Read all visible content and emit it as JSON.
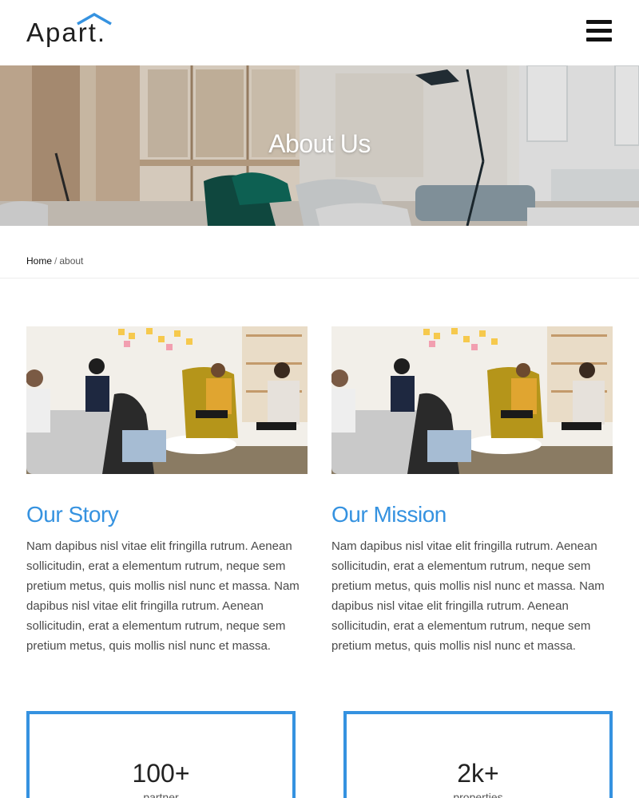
{
  "header": {
    "logo_text": "Apart.",
    "menu_icon": "hamburger-menu-icon"
  },
  "hero": {
    "title": "About Us"
  },
  "breadcrumb": {
    "home": "Home",
    "separator": "/",
    "current": "about"
  },
  "sections": [
    {
      "title": "Our Story",
      "text": "Nam dapibus nisl vitae elit fringilla rutrum. Aenean sollicitudin, erat a elementum rutrum, neque sem pretium metus, quis mollis nisl nunc et massa. Nam dapibus nisl vitae elit fringilla rutrum. Aenean sollicitudin, erat a elementum rutrum, neque sem pretium metus, quis mollis nisl nunc et massa."
    },
    {
      "title": "Our Mission",
      "text": "Nam dapibus nisl vitae elit fringilla rutrum. Aenean sollicitudin, erat a elementum rutrum, neque sem pretium metus, quis mollis nisl nunc et massa. Nam dapibus nisl vitae elit fringilla rutrum. Aenean sollicitudin, erat a elementum rutrum, neque sem pretium metus, quis mollis nisl nunc et massa."
    }
  ],
  "stats": [
    {
      "value": "100+",
      "label": "partner"
    },
    {
      "value": "2k+",
      "label": "properties"
    }
  ],
  "colors": {
    "accent": "#3592e0",
    "text": "#4a4a4a",
    "logo": "#1f1f1f"
  }
}
